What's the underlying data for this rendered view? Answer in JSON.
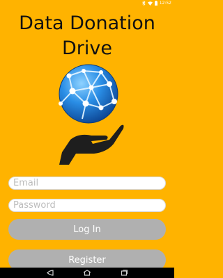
{
  "status_bar": {
    "time": "12:52",
    "icons": [
      "bluetooth-icon",
      "wifi-icon",
      "battery-icon"
    ]
  },
  "app": {
    "title_line1": "Data Donation",
    "title_line2": "Drive",
    "logo_icon": "globe-in-hand-icon",
    "accent_color": "#ffb300"
  },
  "login_form": {
    "email_placeholder": "Email",
    "email_value": "",
    "password_placeholder": "Password",
    "password_value": "",
    "login_label": "Log In",
    "register_label": "Register",
    "button_color": "#b0b0b0"
  },
  "nav_bar": {
    "icons": [
      "back-icon",
      "home-icon",
      "recents-icon"
    ]
  }
}
